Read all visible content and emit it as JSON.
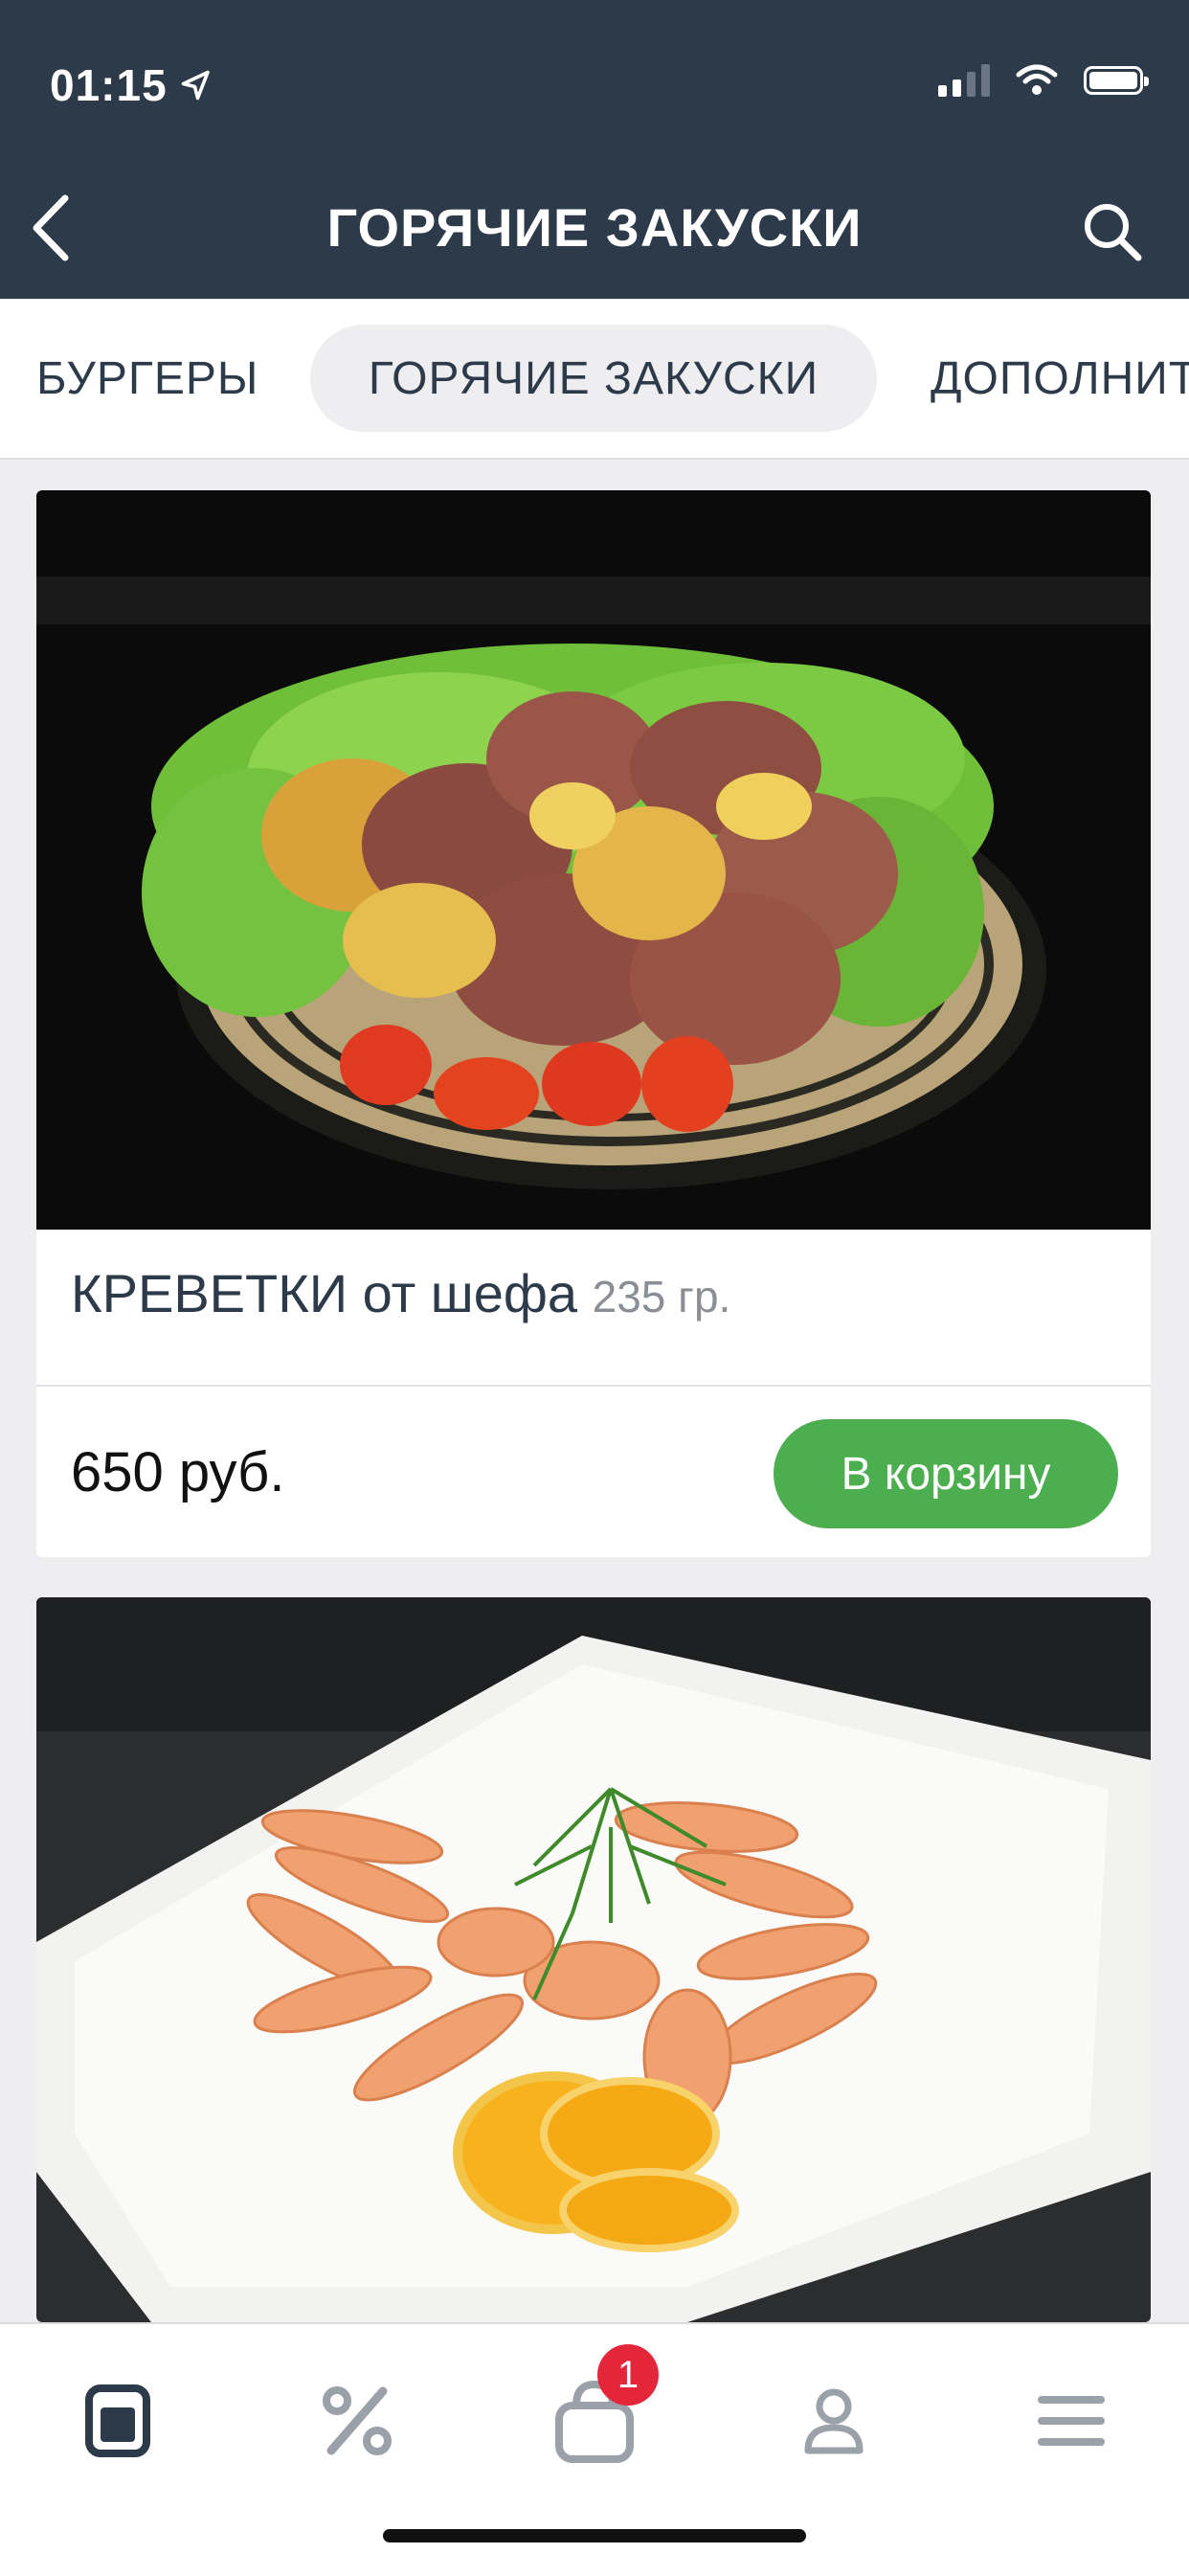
{
  "status_bar": {
    "time": "01:15"
  },
  "header": {
    "title": "ГОРЯЧИЕ ЗАКУСКИ"
  },
  "tabs": [
    {
      "label": "БУРГЕРЫ"
    },
    {
      "label": "ГОРЯЧИЕ ЗАКУСКИ",
      "active": true
    },
    {
      "label": "ДОПОЛНИТ"
    }
  ],
  "products": [
    {
      "name": "КРЕВЕТКИ от шефа",
      "weight": "235 гр.",
      "price": "650 руб.",
      "cart_label": "В корзину"
    }
  ],
  "bottom_nav": {
    "items": [
      "menu-icon",
      "percent-icon",
      "cart-icon",
      "profile-icon",
      "hamburger-icon"
    ],
    "cart_badge": "1"
  },
  "colors": {
    "header_bg": "#2d3a4a",
    "accent_green": "#4cae4f",
    "badge_red": "#e5263a",
    "page_bg": "#eeeef1"
  }
}
